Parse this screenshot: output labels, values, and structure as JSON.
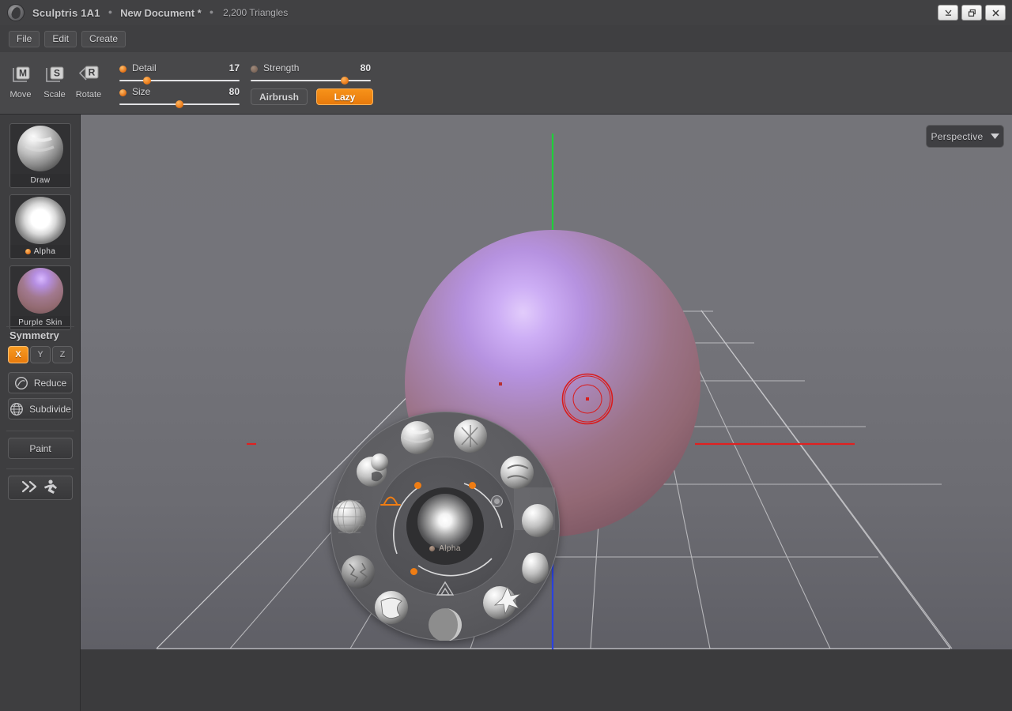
{
  "window": {
    "app_name": "Sculptris 1A1",
    "separator": "●",
    "document_name": "New Document *",
    "triangle_count": "2,200 Triangles",
    "logo_icon": "sculptris-logo-icon",
    "controls": [
      {
        "name": "minimize-button",
        "icon": "minimize-icon"
      },
      {
        "name": "maximize-button",
        "icon": "restore-icon"
      },
      {
        "name": "close-button",
        "icon": "close-icon"
      }
    ]
  },
  "menubar": {
    "items": [
      {
        "label": "File"
      },
      {
        "label": "Edit"
      },
      {
        "label": "Create"
      }
    ]
  },
  "toolbar": {
    "transform_tools": [
      {
        "key": "M",
        "label": "Move"
      },
      {
        "key": "S",
        "label": "Scale"
      },
      {
        "key": "R",
        "label": "Rotate"
      }
    ],
    "sliders": [
      {
        "name": "detail",
        "label": "Detail",
        "value": "17",
        "percent": 23,
        "active": true
      },
      {
        "name": "size",
        "label": "Size",
        "value": "80",
        "percent": 50,
        "active": true
      },
      {
        "name": "strength",
        "label": "Strength",
        "value": "80",
        "percent": 78,
        "active": false
      }
    ],
    "airbrush": {
      "label": "Airbrush",
      "active": false
    },
    "lazy": {
      "label": "Lazy",
      "active": true
    }
  },
  "sidebar": {
    "cards": [
      {
        "name": "brush-preview-card",
        "caption": "Draw",
        "has_dot": false
      },
      {
        "name": "alpha-preview-card",
        "caption": "Alpha",
        "has_dot": true
      },
      {
        "name": "material-preview-card",
        "caption": "Purple Skin",
        "has_dot": false
      }
    ],
    "symmetry": {
      "heading": "Symmetry",
      "axes": [
        {
          "label": "X",
          "active": true
        },
        {
          "label": "Y",
          "active": false
        },
        {
          "label": "Z",
          "active": false
        }
      ]
    },
    "mesh_buttons": [
      {
        "label": "Reduce",
        "icon": "reduce-circle-icon"
      },
      {
        "label": "Subdivide",
        "icon": "subdivide-globe-icon"
      }
    ],
    "paint_button": {
      "label": "Paint"
    },
    "run_button": {
      "label": "",
      "icon": "fast-forward-runner-icon"
    }
  },
  "viewport": {
    "projection": {
      "label": "Perspective",
      "icon": "chevron-down-icon"
    },
    "axis_colors": {
      "y_axis": "#1fcf3a",
      "x_axis": "#e02020",
      "z_axis": "#2a42e0",
      "grid_line": "#c9c9cc"
    },
    "cursor": {
      "name": "brush-cursor",
      "color": "#d91c1c",
      "radius": "30"
    },
    "model": {
      "name": "sphere-mesh",
      "material": "Purple Skin",
      "highlight_color": "#c9a3f2",
      "base_color": "#9a6d7e"
    }
  },
  "radial_menu": {
    "center_label": "Alpha",
    "center_icon": "alpha-falloff-preview",
    "falloff_icon": "curve-falloff-icon",
    "mirror_icon": "triangle-mirror-icon",
    "brushes": [
      {
        "name": "brush-draw",
        "index": 0
      },
      {
        "name": "brush-crease",
        "index": 1
      },
      {
        "name": "brush-inflate",
        "index": 2
      },
      {
        "name": "brush-flatten",
        "index": 3
      },
      {
        "name": "brush-smooth",
        "index": 4
      },
      {
        "name": "brush-rotate",
        "index": 5
      },
      {
        "name": "brush-pinch",
        "index": 6
      },
      {
        "name": "brush-grab",
        "index": 7
      },
      {
        "name": "brush-scale",
        "index": 8
      },
      {
        "name": "brush-mask",
        "index": 9
      },
      {
        "name": "brush-noise",
        "index": 10
      },
      {
        "name": "brush-reduce",
        "index": 11
      }
    ],
    "markers": [
      {
        "name": "falloff-handle-left"
      },
      {
        "name": "falloff-handle-top"
      },
      {
        "name": "falloff-handle-bottom"
      }
    ]
  }
}
